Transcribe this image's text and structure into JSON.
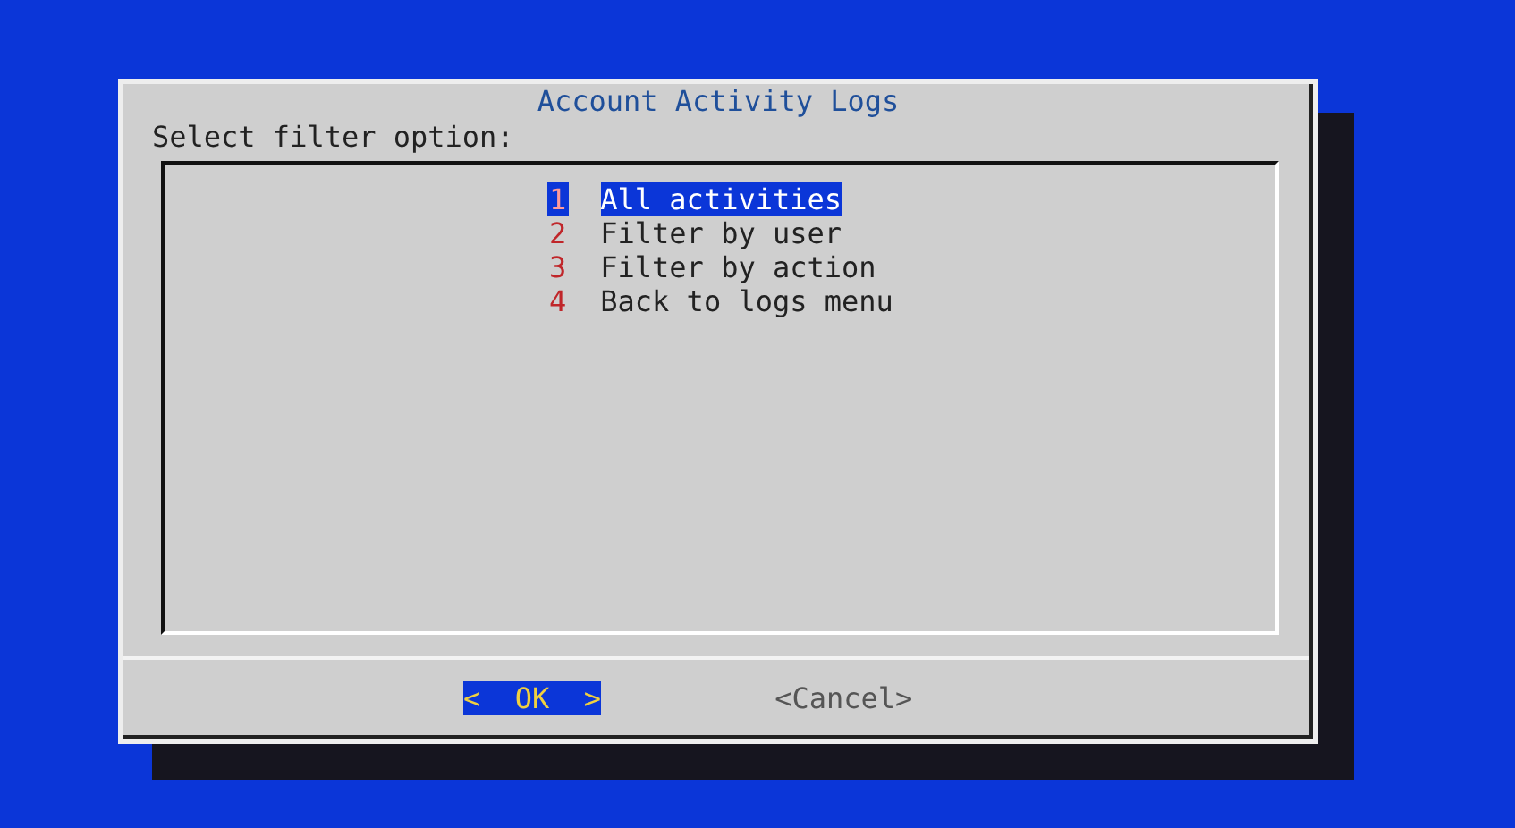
{
  "dialog": {
    "title": "Account Activity Logs",
    "prompt": "Select filter option:"
  },
  "menu": [
    {
      "tag": "1",
      "label": "All activities",
      "selected": true
    },
    {
      "tag": "2",
      "label": "Filter by user",
      "selected": false
    },
    {
      "tag": "3",
      "label": "Filter by action",
      "selected": false
    },
    {
      "tag": "4",
      "label": "Back to logs menu",
      "selected": false
    }
  ],
  "buttons": [
    {
      "label": "<  OK  >",
      "selected": true
    },
    {
      "label": "<Cancel>",
      "selected": false
    }
  ]
}
